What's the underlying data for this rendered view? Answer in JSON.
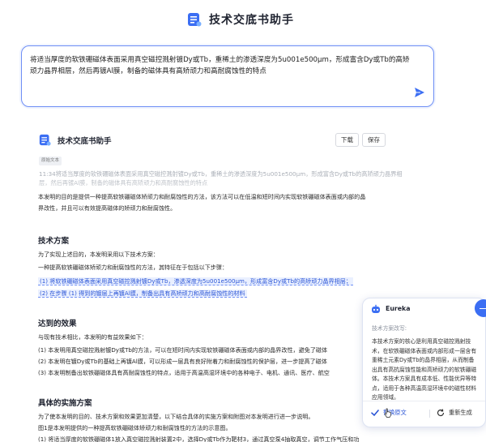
{
  "app": {
    "title": "技术交底书助手"
  },
  "prompt": {
    "text": "将适当厚度的软铁硼磁体表面采用真空磁控溅射镀Dy或Tb，重稀土的渗透深度为5u001e500μm，形成富含Dy或Tb的高矫顽力晶界相层，然后再镀Al膜，制备的磁体具有高矫顽力和高耐腐蚀性的特点"
  },
  "doc": {
    "title": "技术交底书助手",
    "download_label": "下载",
    "save_label": "保存",
    "original_tag": "原始文本",
    "original_text": "11:34将适当厚度的软铁硼磁体表面采用真空磁控溅射镀Dy或Tb，重稀土的渗透深度为5u001e500μm，形成富含Dy或Tb的高矫顽力晶界相层，然后再镀Al膜，制备的磁体具有高矫顽力和高耐腐蚀性的特点",
    "intro_lines": [
      "本发明的目的是提供一种提高软铁硼磁体矫顽力和耐腐蚀性的方法，该方法可以在低温和短时间内实现软铁硼磁体表面或内部的晶",
      "界改性，并且可以有效提高磁体的矫顽力和耐腐蚀性。"
    ],
    "sections": {
      "tech": {
        "heading": "技术方案",
        "lines": [
          "为了实现上述目的，本发明采用以下技术方案：",
          "一种提高软铁硼磁体矫顽力和耐腐蚀性的方法，其特征在于包括以下步骤："
        ],
        "highlight_lines": [
          "(1) 将软铁硼磁体表面采用真空磁控溅射镀Dy或Tb，渗透深度为5u001e500μm，形成富含Dy或Tb的高矫顽力晶界相层；",
          "(2) 在步骤 (1) 得到的镀层上再镀Al膜，制备出具有高矫顽力和高耐腐蚀性的材料"
        ]
      },
      "effect": {
        "heading": "达到的效果",
        "lines": [
          "与现有技术相比，本发明的有益效果如下：",
          "(1) 本发明用真空磁控溅射镀Dy或Tb的方法，可以在短时间内实现软铁硼磁体表面或内部的晶界改性，避免了磁体",
          "(2) 本发明在镀Dy或Tb的基础上再镀Al膜，可以形成一层具有良好附着力和耐腐蚀性的保护层，进一步提高了磁体",
          "(3) 本发明制备出软铁硼磁体具有高耐腐蚀性的特点，适用于高温高湿环境中的各种电子、电机、通讯、医疗、航空"
        ]
      },
      "impl": {
        "heading": "具体的实施方案",
        "lines": [
          "为了使本发明的目的、技术方案和效果更加清楚，以下结合具体的实施方案和附图对本发明进行进一步说明。",
          "图1是本发明提供的一种提高软铁硼磁体矫顽力和耐腐蚀性的方法的示意图。",
          "(1) 将适当厚度的软铁硼磁体1放入真空磁控溅射装置2中，选择Dy或Tb作为靶材3，通过真空泵4抽取真空，调节工作气压和功"
        ]
      }
    }
  },
  "eureka": {
    "title": "Eureka",
    "subtitle": "技术方案改写:",
    "body": "本技术方案的核心是利用真空磁控溅射技术，在软铁硼磁体表面或内部形成一层含有重稀土元素Dy或Tb的晶界相层，从而制备出具有高抗腐蚀性能和高矫顽力的软铁硼磁体。本技术方案具有成本低、性能优异等特点，适用于各种高温高湿环境中的磁性材料应用领域。",
    "replace_label": "替换原文",
    "regen_label": "重新生成"
  },
  "colors": {
    "accent": "#3b6ef3",
    "highlight_text": "#2b55d6",
    "highlight_bg": "#eaf0ff"
  },
  "icons": [
    "app-logo-icon",
    "send-icon",
    "doc-logo-icon",
    "eureka-logo-icon",
    "minimize-icon",
    "check-icon",
    "refresh-icon",
    "hand-cursor-icon"
  ]
}
